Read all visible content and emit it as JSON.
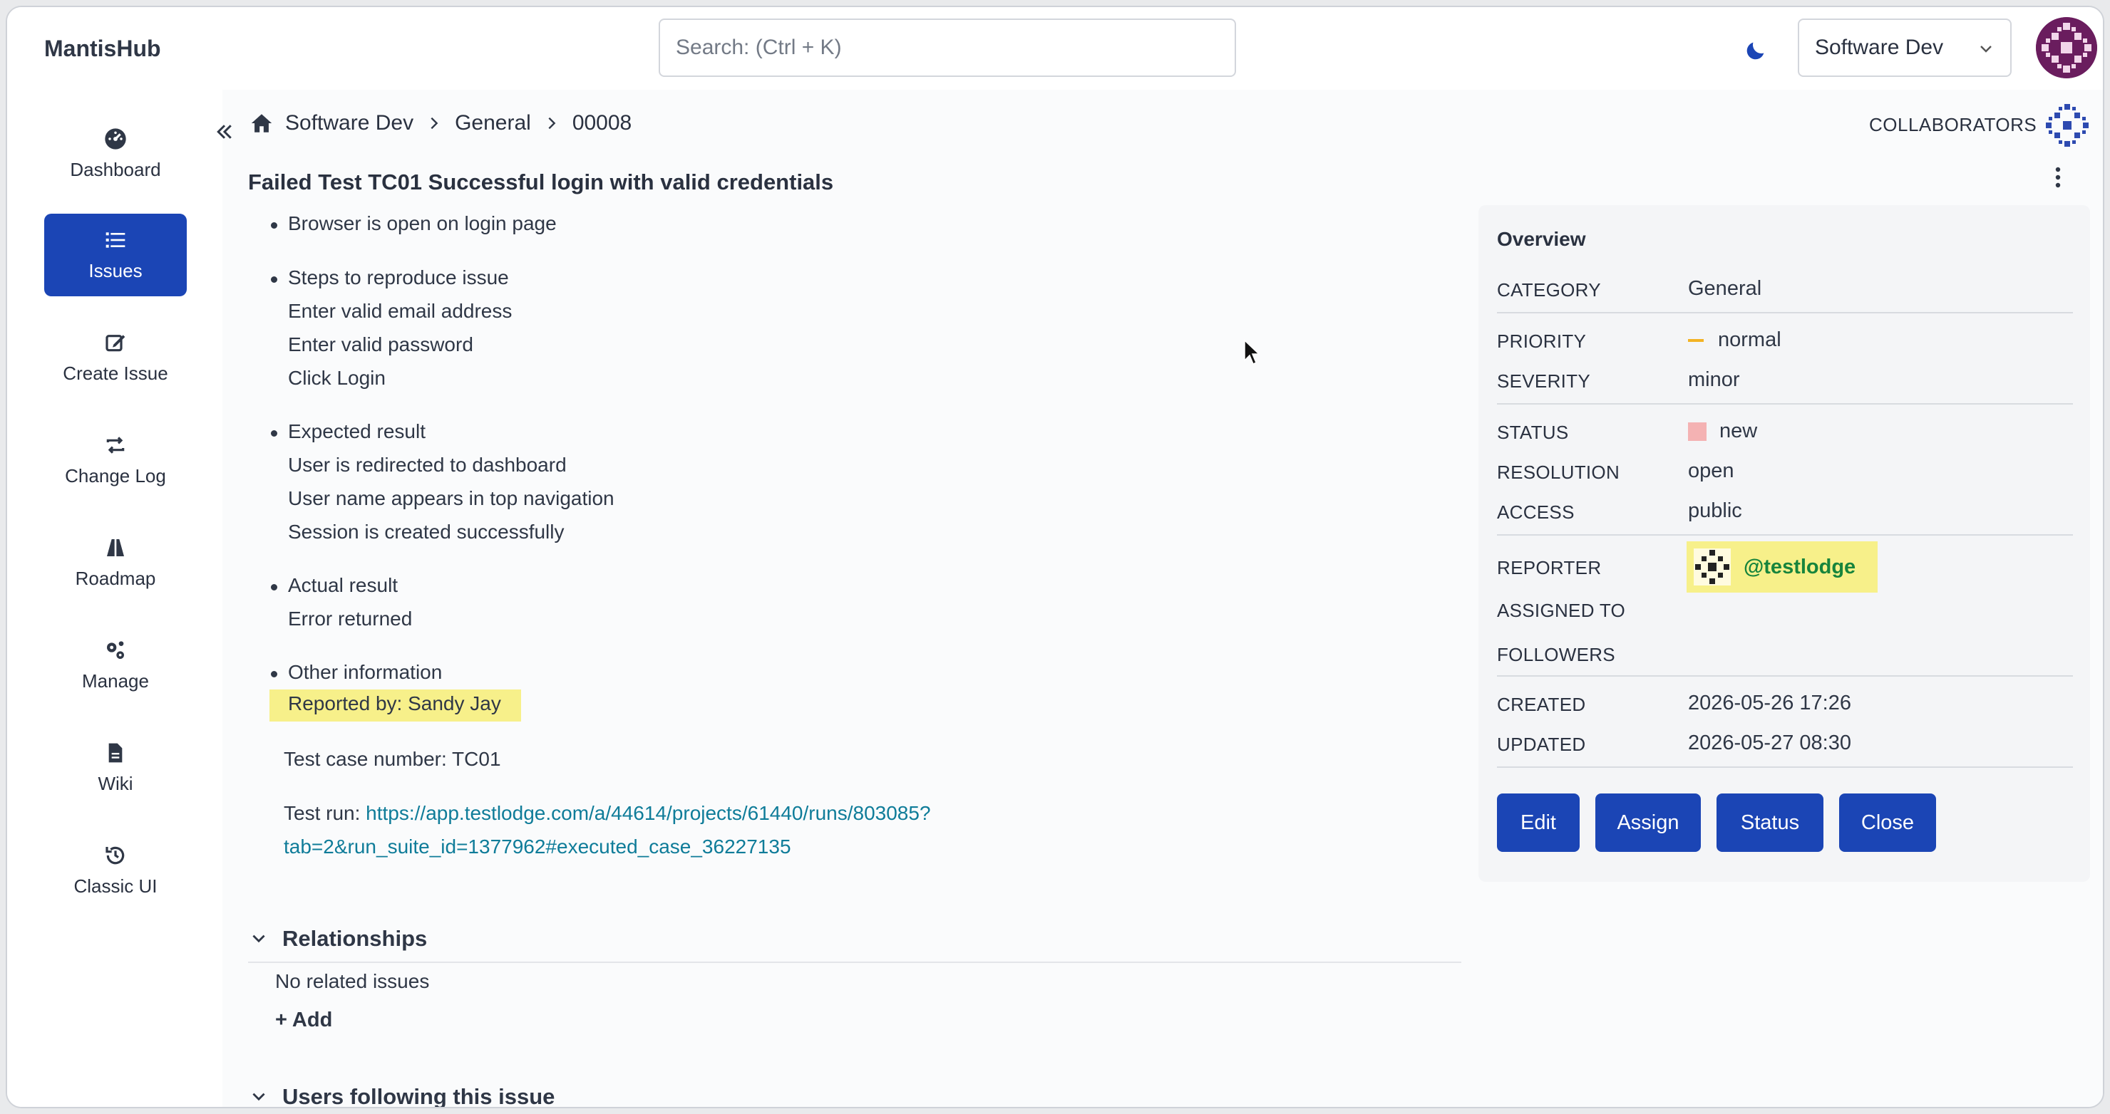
{
  "app": {
    "brand": "MantisHub"
  },
  "search": {
    "placeholder": "Search: (Ctrl + K)"
  },
  "project_select": {
    "value": "Software Dev"
  },
  "sidebar": {
    "items": [
      {
        "label": "Dashboard",
        "icon": "dashboard-icon"
      },
      {
        "label": "Issues",
        "icon": "list-icon",
        "active": true
      },
      {
        "label": "Create Issue",
        "icon": "edit-icon"
      },
      {
        "label": "Change Log",
        "icon": "changelog-icon"
      },
      {
        "label": "Roadmap",
        "icon": "road-icon"
      },
      {
        "label": "Manage",
        "icon": "gears-icon"
      },
      {
        "label": "Wiki",
        "icon": "file-icon"
      },
      {
        "label": "Classic UI",
        "icon": "history-icon"
      }
    ]
  },
  "breadcrumb": {
    "project": "Software Dev",
    "category": "General",
    "issue_id": "00008"
  },
  "collaborators_label": "COLLABORATORS",
  "issue": {
    "title": "Failed Test TC01 Successful login with valid credentials",
    "description": {
      "b1": "Browser is open on login page",
      "b2": "Steps to reproduce issue",
      "b2_s1": "Enter valid email address",
      "b2_s2": "Enter valid password",
      "b2_s3": "Click Login",
      "b3": "Expected result",
      "b3_s1": "User is redirected to dashboard",
      "b3_s2": "User name appears in top navigation",
      "b3_s3": "Session is created successfully",
      "b4": "Actual result",
      "b4_s1": "Error returned",
      "b5": "Other information",
      "b5_s1": "Reported by: Sandy Jay",
      "test_case": "Test case number: TC01",
      "test_run_label": "Test run: ",
      "test_run_url_line1": "https://app.testlodge.com/a/44614/projects/61440/runs/803085?",
      "test_run_url_line2": "tab=2&run_suite_id=1377962#executed_case_36227135"
    }
  },
  "relationships": {
    "title": "Relationships",
    "empty": "No related issues",
    "add": "+ Add"
  },
  "followers_section": {
    "title": "Users following this issue"
  },
  "overview": {
    "title": "Overview",
    "category_label": "CATEGORY",
    "category": "General",
    "priority_label": "PRIORITY",
    "priority": "normal",
    "severity_label": "SEVERITY",
    "severity": "minor",
    "status_label": "STATUS",
    "status": "new",
    "resolution_label": "RESOLUTION",
    "resolution": "open",
    "access_label": "ACCESS",
    "access": "public",
    "reporter_label": "REPORTER",
    "reporter": "@testlodge",
    "assigned_label": "ASSIGNED TO",
    "followers_label": "FOLLOWERS",
    "created_label": "CREATED",
    "created": "2026-05-26 17:26",
    "updated_label": "UPDATED",
    "updated": "2026-05-27 08:30",
    "colors": {
      "priority_dash": "#f3b324",
      "status_new": "#f4b2b3"
    }
  },
  "actions": {
    "edit": "Edit",
    "assign": "Assign",
    "status": "Status",
    "close": "Close"
  },
  "colors": {
    "primary": "#1b45b5",
    "link": "#0f7c99",
    "highlight": "#f7f08a",
    "reporter": "#17843c"
  }
}
